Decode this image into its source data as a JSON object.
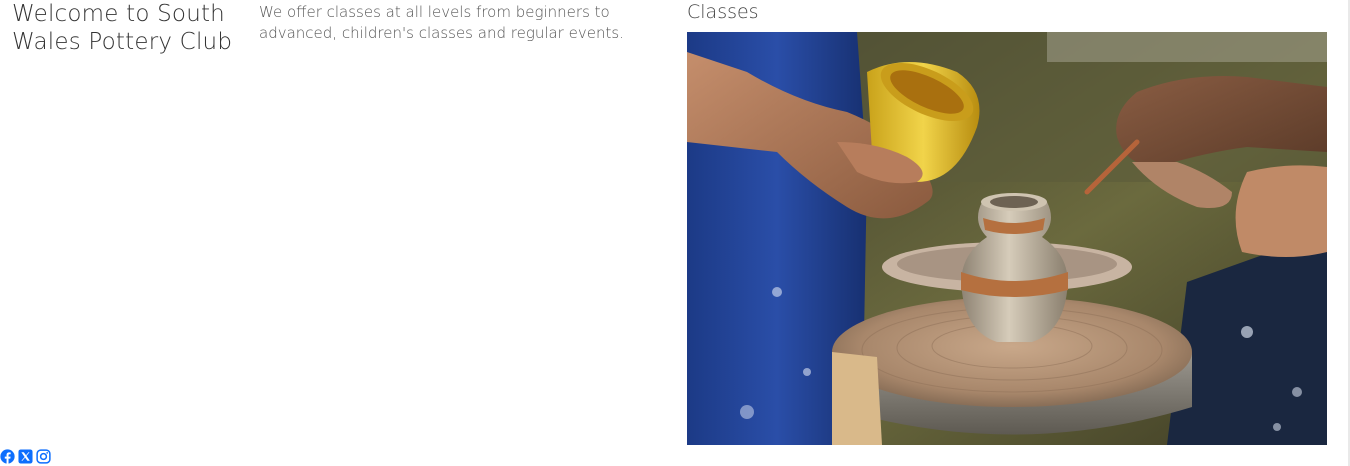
{
  "intro": {
    "title": "Welcome to South Wales Pottery Club",
    "text": "We offer classes at all levels from beginners to advanced, children's classes and regular events."
  },
  "classes": {
    "heading": "Classes",
    "image_icon": "pottery-wheel-photo"
  },
  "social": {
    "color": "#0d6efd",
    "links": [
      {
        "icon": "facebook-icon"
      },
      {
        "icon": "x-twitter-icon"
      },
      {
        "icon": "instagram-icon"
      }
    ]
  },
  "colors": {
    "heading_text": "#333333",
    "body_text": "#555555",
    "link_blue": "#0d6efd"
  }
}
